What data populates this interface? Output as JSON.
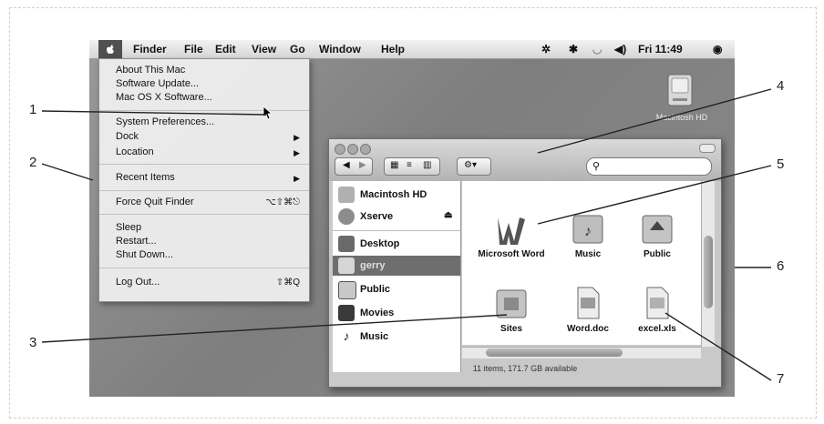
{
  "menubar": {
    "items": [
      "Finder",
      "File",
      "Edit",
      "View",
      "Go",
      "Window",
      "Help"
    ],
    "clock": "Fri 11:49"
  },
  "apple_menu": {
    "items": [
      {
        "label": "About This Mac"
      },
      {
        "label": "Software Update..."
      },
      {
        "label": "Mac OS X Software..."
      },
      {
        "label": "System Preferences..."
      },
      {
        "label": "Dock",
        "submenu": true
      },
      {
        "label": "Location",
        "submenu": true
      },
      {
        "label": "Recent Items",
        "submenu": true
      },
      {
        "label": "Force Quit Finder",
        "shortcut": "⌥⇧⌘⎋"
      },
      {
        "label": "Sleep"
      },
      {
        "label": "Restart..."
      },
      {
        "label": "Shut Down..."
      },
      {
        "label": "Log Out...",
        "shortcut": "⇧⌘Q"
      }
    ]
  },
  "desktop": {
    "hd_label": "Macintosh HD"
  },
  "finder": {
    "sidebar": [
      {
        "label": "Macintosh HD"
      },
      {
        "label": "Xserve"
      },
      {
        "label": "Desktop"
      },
      {
        "label": "gerry",
        "selected": true
      },
      {
        "label": "Public"
      },
      {
        "label": "Movies"
      },
      {
        "label": "Music"
      }
    ],
    "items": [
      "Microsoft Word",
      "Music",
      "Public",
      "Sites",
      "Word.doc",
      "excel.xls"
    ],
    "status": "11 items, 171.7 GB available"
  },
  "callouts": [
    "1",
    "2",
    "3",
    "4",
    "5",
    "6",
    "7"
  ],
  "colors": {
    "selected": "#6e6e6e",
    "menubar": "#e3e3e3",
    "desktop": "#8a8a8a"
  }
}
